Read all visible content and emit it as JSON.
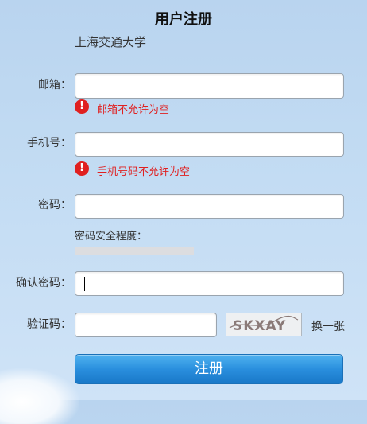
{
  "form": {
    "title": "用户注册",
    "school": "上海交通大学",
    "email": {
      "label": "邮箱：",
      "value": "",
      "error": "邮箱不允许为空"
    },
    "phone": {
      "label": "手机号：",
      "value": "",
      "error": "手机号码不允许为空"
    },
    "password": {
      "label": "密码：",
      "value": "",
      "strength_label": "密码安全程度："
    },
    "confirm_password": {
      "label": "确认密码：",
      "value": ""
    },
    "captcha": {
      "label": "验证码：",
      "value": "",
      "image_text": "SKXAY",
      "refresh_label": "换一张"
    },
    "submit_label": "注册"
  },
  "colors": {
    "error": "#e02020",
    "button": "#2a8fde"
  },
  "icons": {
    "error": "exclamation-circle-icon"
  }
}
